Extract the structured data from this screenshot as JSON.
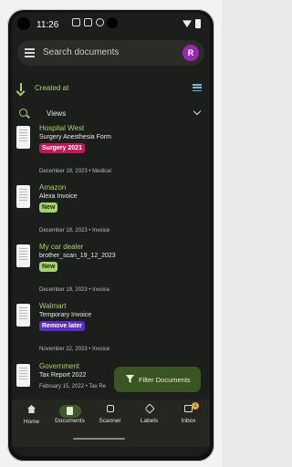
{
  "status_bar": {
    "time": "11:26"
  },
  "search": {
    "placeholder": "Search documents",
    "avatar_initial": "R"
  },
  "sort": {
    "label": "Created at"
  },
  "views": {
    "label": "Views"
  },
  "documents": [
    {
      "correspondent": "Hospital West",
      "title": "Surgery Anesthesia Form",
      "tag": "Surgery 2021",
      "tag_color": "#c2185b",
      "date": "December 19, 2023",
      "type": "Medical"
    },
    {
      "correspondent": "Amazon",
      "title": "Alexa Invoice",
      "tag": "New",
      "tag_color": "#a5d36c",
      "date": "December 19, 2023",
      "type": "Invoice"
    },
    {
      "correspondent": "My car dealer",
      "title": "brother_scan_19_12_2023",
      "tag": "New",
      "tag_color": "#a5d36c",
      "date": "December 19, 2023",
      "type": "Invoice"
    },
    {
      "correspondent": "Walmart",
      "title": "Temporary Invoice",
      "tag": "Remove later",
      "tag_color": "#5a2dc9",
      "date": "November 22, 2023",
      "type": "Invoice"
    },
    {
      "correspondent": "Government",
      "title": "Tax Report 2022",
      "tag": "",
      "tag_color": "",
      "date": "February 15, 2022",
      "type": "Tax Re"
    }
  ],
  "fab": {
    "label": "Filter Documents"
  },
  "bottom_nav": [
    {
      "label": "Home",
      "icon": "home-icon"
    },
    {
      "label": "Documents",
      "icon": "document-icon"
    },
    {
      "label": "Scanner",
      "icon": "scanner-icon"
    },
    {
      "label": "Labels",
      "icon": "label-icon"
    },
    {
      "label": "Inbox",
      "icon": "inbox-icon",
      "badge": "1"
    }
  ]
}
